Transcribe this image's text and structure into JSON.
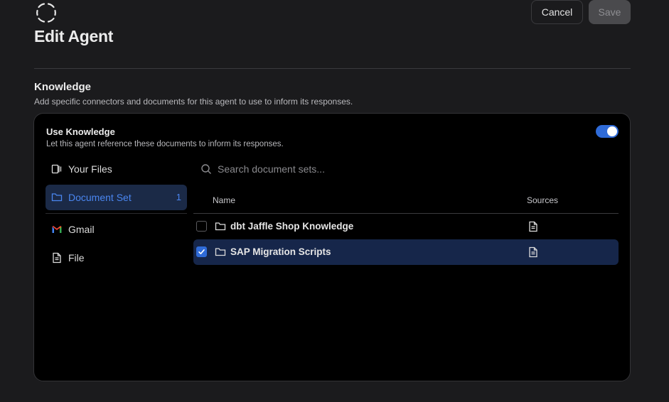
{
  "header": {
    "title": "Edit Agent",
    "cancel_label": "Cancel",
    "save_label": "Save"
  },
  "knowledge": {
    "title": "Knowledge",
    "description": "Add specific connectors and documents for this agent to use to inform its responses.",
    "use_knowledge": {
      "title": "Use Knowledge",
      "description": "Let this agent reference these documents to inform its responses.",
      "enabled": true
    }
  },
  "sidebar": {
    "items": [
      {
        "label": "Your Files",
        "icon": "files-icon"
      },
      {
        "label": "Document Set",
        "icon": "folder-icon",
        "count": "1",
        "active": true
      },
      {
        "label": "Gmail",
        "icon": "gmail-icon"
      },
      {
        "label": "File",
        "icon": "file-icon"
      }
    ]
  },
  "search": {
    "placeholder": "Search document sets..."
  },
  "table": {
    "columns": [
      "Name",
      "Sources"
    ],
    "rows": [
      {
        "name": "dbt Jaffle Shop Knowledge",
        "checked": false,
        "source_icon": "document-icon"
      },
      {
        "name": "SAP Migration Scripts",
        "checked": true,
        "source_icon": "document-icon"
      }
    ]
  },
  "colors": {
    "accent": "#2f6bd8",
    "selected_row": "#16264a",
    "background": "#1b1b1d",
    "card": "#000000"
  }
}
